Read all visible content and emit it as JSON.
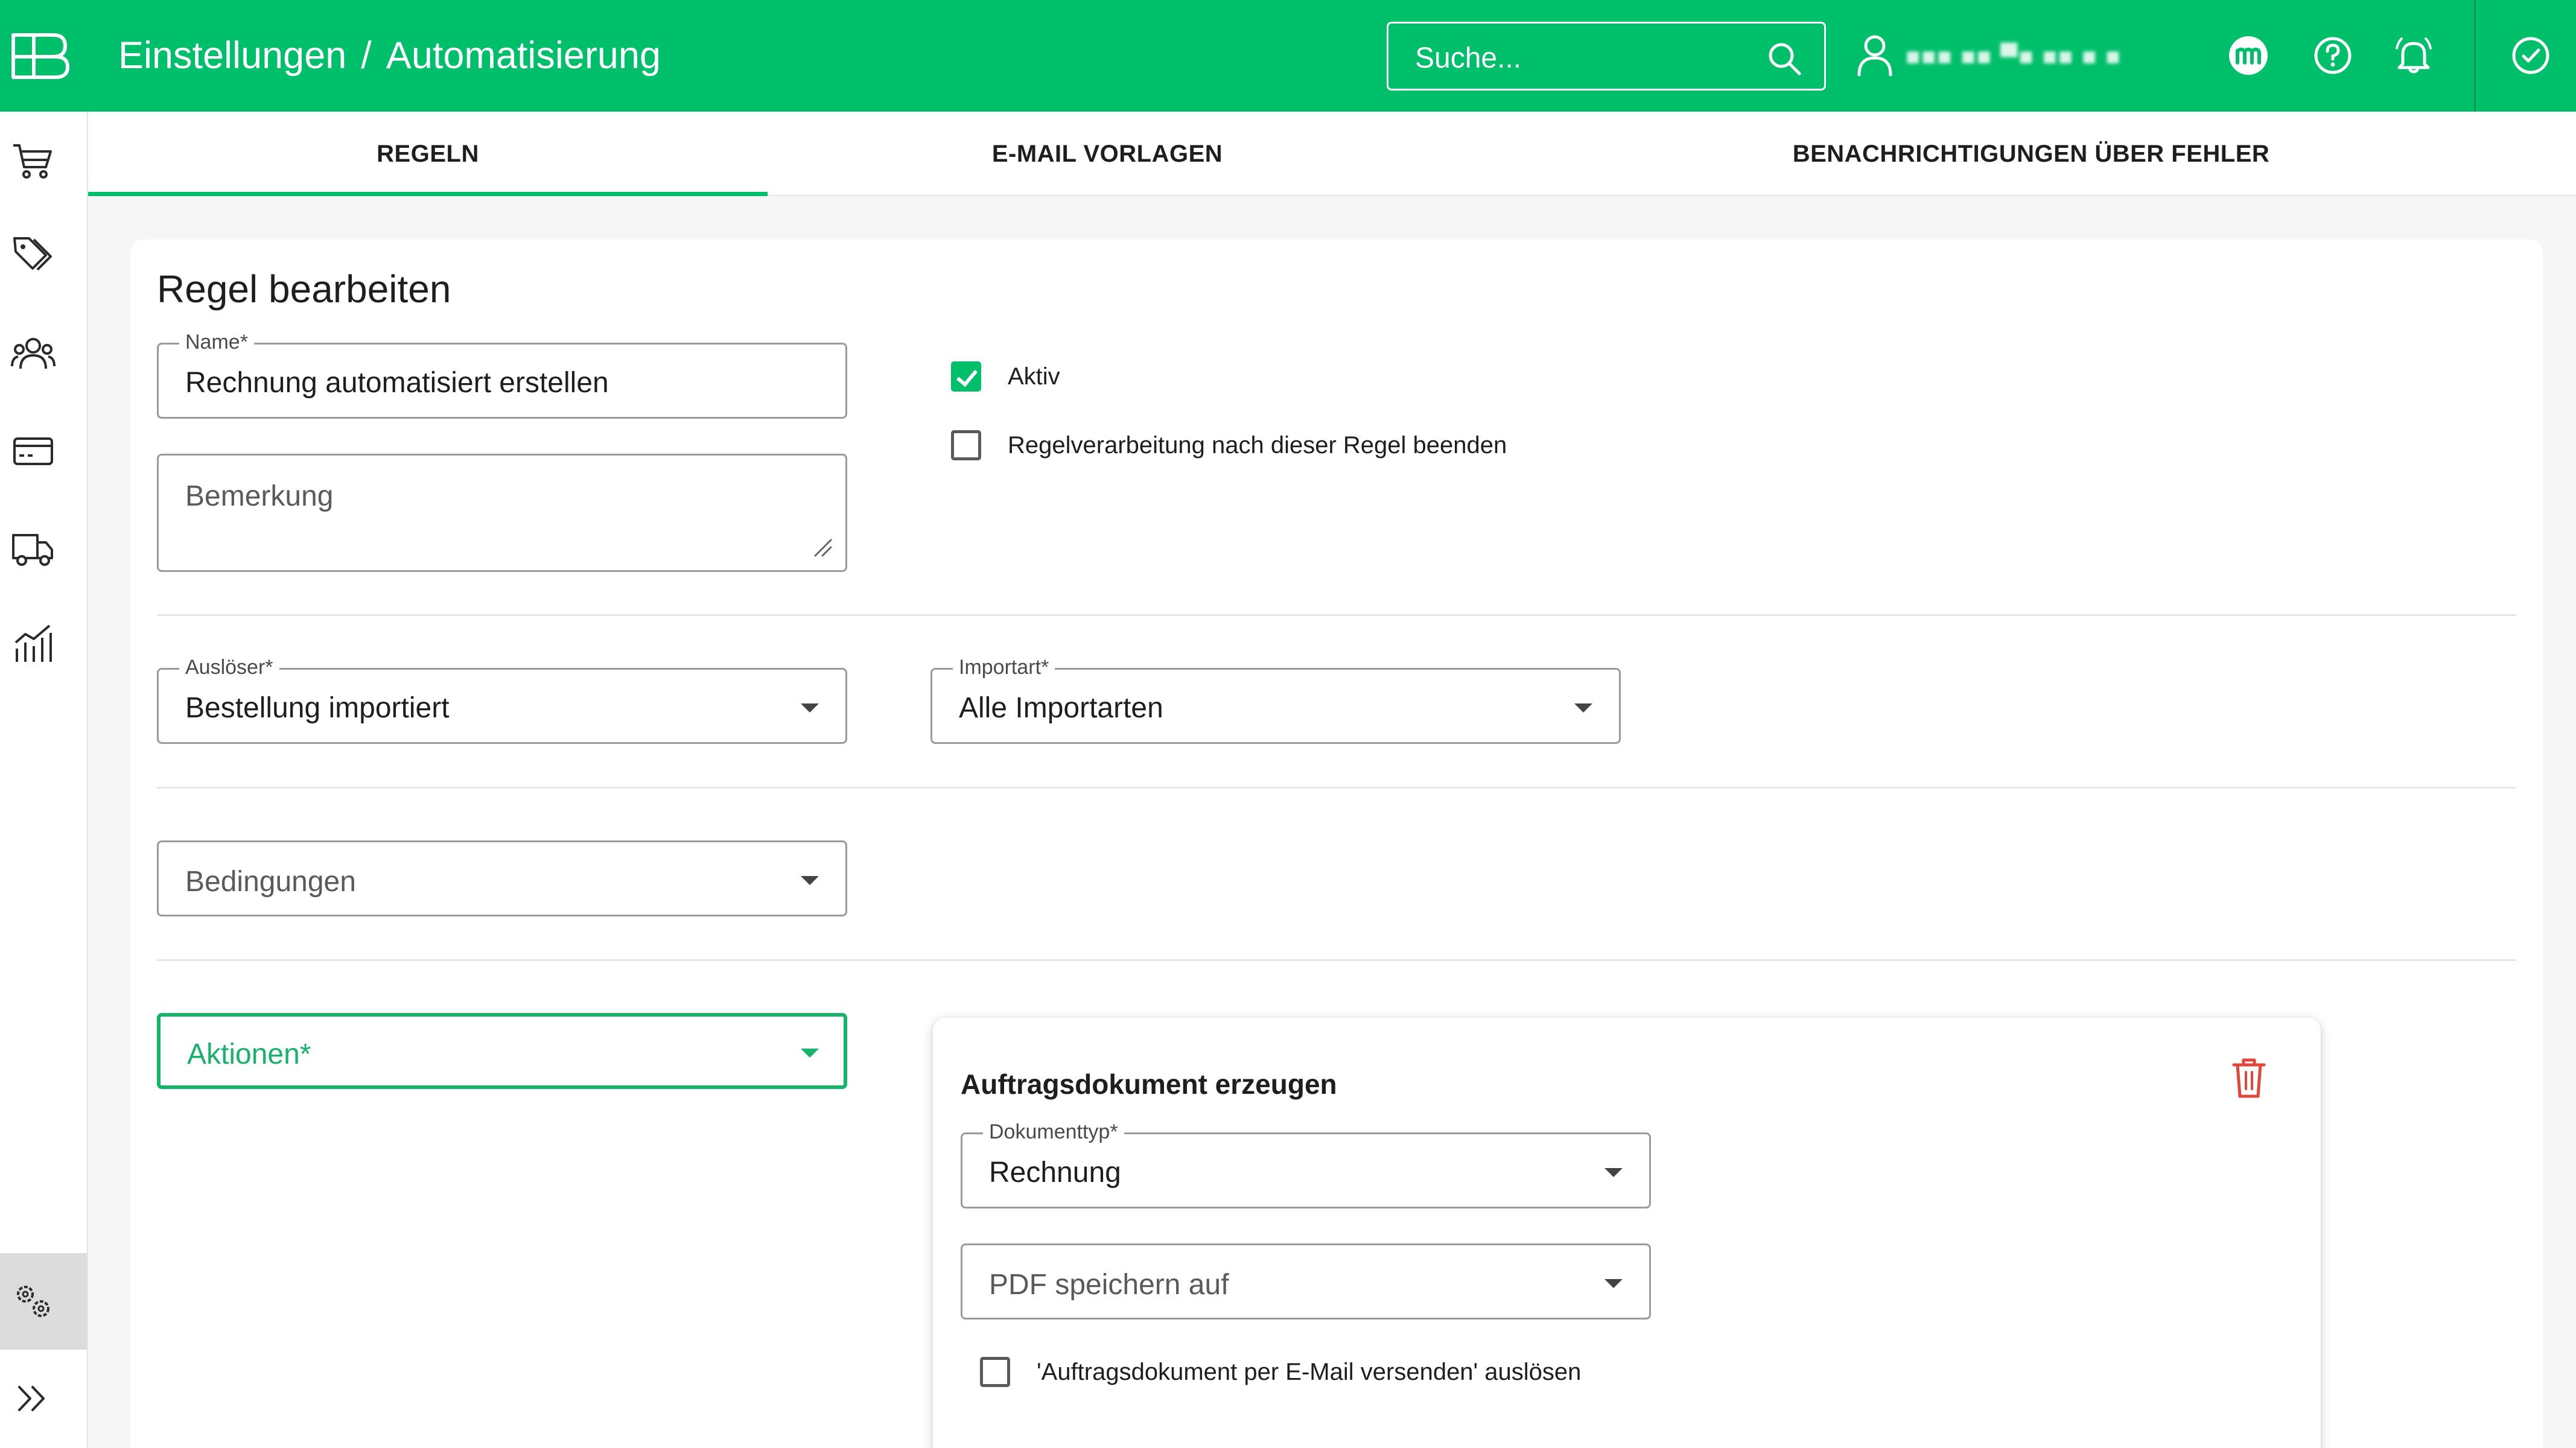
{
  "header": {
    "breadcrumb_section": "Einstellungen",
    "breadcrumb_separator": "/",
    "breadcrumb_page": "Automatisierung",
    "search_placeholder": "Suche...",
    "user_name_redacted": "■■■ ■■ ▀■ ■■ ■ ■"
  },
  "tabs": [
    {
      "label": "REGELN",
      "active": true
    },
    {
      "label": "E-MAIL VORLAGEN",
      "active": false
    },
    {
      "label": "BENACHRICHTIGUNGEN ÜBER FEHLER",
      "active": false
    }
  ],
  "sidebar": {
    "icons": [
      "cart-icon",
      "tags-icon",
      "customers-icon",
      "payment-card-icon",
      "truck-icon",
      "analytics-icon",
      "settings-gears-icon",
      "expand-chevrons-icon"
    ],
    "active": "settings-gears-icon"
  },
  "form": {
    "title": "Regel bearbeiten",
    "name_label": "Name*",
    "name_value": "Rechnung automatisiert erstellen",
    "remark_placeholder": "Bemerkung",
    "active_label": "Aktiv",
    "active_checked": true,
    "stop_label": "Regelverarbeitung nach dieser Regel beenden",
    "stop_checked": false,
    "trigger_label": "Auslöser*",
    "trigger_value": "Bestellung importiert",
    "importtype_label": "Importart*",
    "importtype_value": "Alle Importarten",
    "conditions_placeholder": "Bedingungen",
    "actions_placeholder": "Aktionen*"
  },
  "action_card": {
    "title": "Auftragsdokument erzeugen",
    "doctype_label": "Dokumenttyp*",
    "doctype_value": "Rechnung",
    "pdf_placeholder": "PDF speichern auf",
    "email_trigger_label": "'Auftragsdokument per E-Mail versenden' auslösen",
    "email_trigger_checked": false
  },
  "colors": {
    "brand": "#00bf6b",
    "focus": "#16b36a",
    "danger": "#e0463a"
  }
}
